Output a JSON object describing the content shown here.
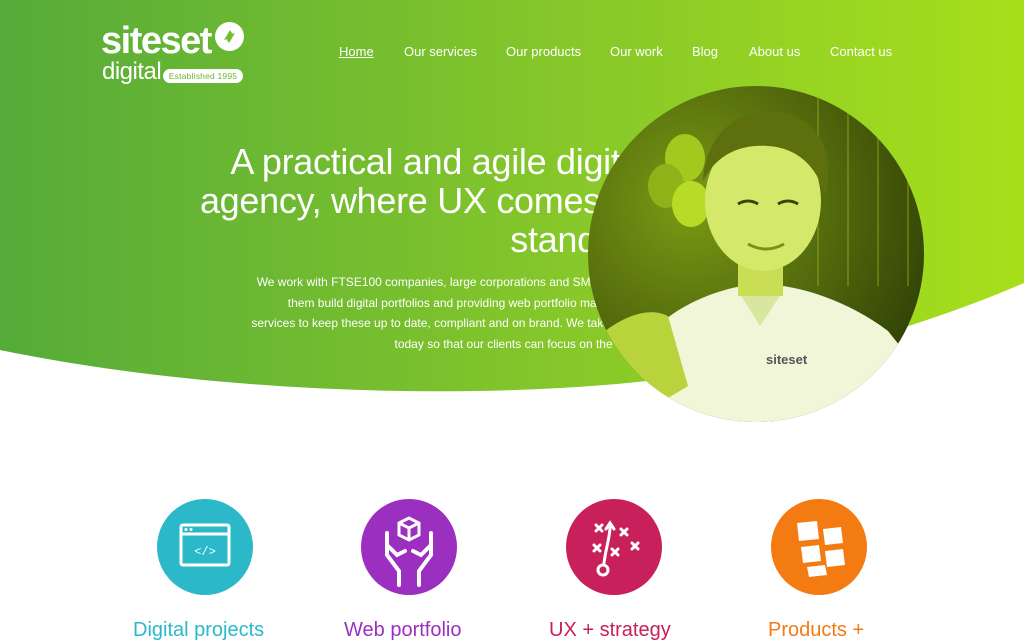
{
  "brand": {
    "name_line1": "siteset",
    "name_line2": "digital",
    "badge": "Established 1995"
  },
  "nav": [
    {
      "label": "Home",
      "active": true
    },
    {
      "label": "Our services",
      "active": false
    },
    {
      "label": "Our products",
      "active": false
    },
    {
      "label": "Our work",
      "active": false
    },
    {
      "label": "Blog",
      "active": false
    },
    {
      "label": "About us",
      "active": false
    },
    {
      "label": "Contact us",
      "active": false
    }
  ],
  "hero": {
    "headline_lines": [
      "A practical and agile digital",
      "agency, where UX comes as",
      "standard"
    ],
    "intro_lines": [
      "We work with FTSE100 companies, large corporations and SMEs, helping",
      "them build digital portfolios and providing web portfolio management",
      "services to keep these up to date, compliant and on brand. We take care of",
      "today so that our clients can focus on the future."
    ],
    "photo_shirt_logo": "siteset"
  },
  "services": [
    {
      "title": "Digital projects",
      "color": "#2bb9c9",
      "icon": "browser-code-icon"
    },
    {
      "title": "Web portfolio",
      "color": "#9b2fbf",
      "icon": "hands-box-icon"
    },
    {
      "title": "UX + strategy",
      "color": "#c8205a",
      "icon": "strategy-play-icon"
    },
    {
      "title": "Products +",
      "color": "#f47a12",
      "icon": "stacked-screens-icon"
    }
  ],
  "colors": {
    "hero_gradient_start": "#56ad38",
    "hero_gradient_end": "#a8e01a",
    "white": "#ffffff"
  }
}
